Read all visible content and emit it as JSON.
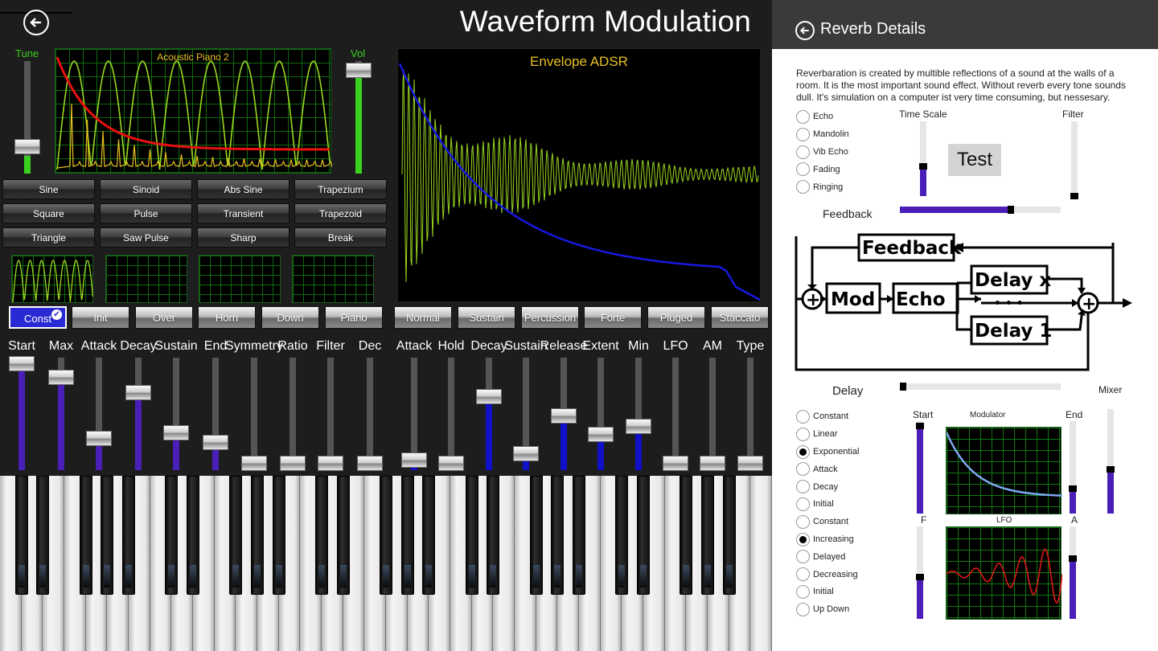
{
  "app": {
    "title": "Waveform Modulation"
  },
  "top_scope": {
    "label": "Acoustic Piano 2",
    "tune_label": "Tune",
    "vol_label": "Vol"
  },
  "envelope_scope": {
    "label": "Envelope ADSR"
  },
  "wave_buttons": [
    "Sine",
    "Sinoid",
    "Abs Sine",
    "Trapezium",
    "Square",
    "Pulse",
    "Transient",
    "Trapezoid",
    "Triangle",
    "Saw Pulse",
    "Sharp",
    "Break"
  ],
  "mode_buttons_left": [
    {
      "label": "Const",
      "active": true
    },
    {
      "label": "Init",
      "active": false
    },
    {
      "label": "Over",
      "active": false
    },
    {
      "label": "Horn",
      "active": false
    },
    {
      "label": "Down",
      "active": false
    },
    {
      "label": "Piano",
      "active": false
    }
  ],
  "mode_buttons_right": [
    {
      "label": "Normal"
    },
    {
      "label": "Sustain"
    },
    {
      "label": "Percussion"
    },
    {
      "label": "Forte"
    },
    {
      "label": "Pluged"
    },
    {
      "label": "Staccato"
    }
  ],
  "sliders": [
    {
      "label": "Start",
      "value": 0.95,
      "color": "#4a1fb8"
    },
    {
      "label": "Max",
      "value": 0.82,
      "color": "#4a1fb8"
    },
    {
      "label": "Attack",
      "value": 0.24,
      "color": "#4a1fb8"
    },
    {
      "label": "Decay",
      "value": 0.68,
      "color": "#4a1fb8"
    },
    {
      "label": "Sustain",
      "value": 0.29,
      "color": "#4a1fb8"
    },
    {
      "label": "End",
      "value": 0.2,
      "color": "#4a1fb8"
    },
    {
      "label": "Symmetry",
      "value": 0.0,
      "color": "#4a1fb8"
    },
    {
      "label": "Ratio",
      "value": 0.0,
      "color": "#4a1fb8"
    },
    {
      "label": "Filter",
      "value": 0.0,
      "color": "#4a1fb8"
    },
    {
      "label": "Dec",
      "value": 0.0,
      "color": "#4a1fb8"
    },
    {
      "label": "Attack",
      "value": 0.03,
      "color": "#1010c8"
    },
    {
      "label": "Hold",
      "value": 0.0,
      "color": "#1010c8"
    },
    {
      "label": "Decay",
      "value": 0.64,
      "color": "#1010c8"
    },
    {
      "label": "Sustain",
      "value": 0.09,
      "color": "#1010c8"
    },
    {
      "label": "Release",
      "value": 0.45,
      "color": "#1010c8"
    },
    {
      "label": "Extent",
      "value": 0.28,
      "color": "#1010c8"
    },
    {
      "label": "Min",
      "value": 0.35,
      "color": "#1010c8"
    },
    {
      "label": "LFO",
      "value": 0.0,
      "color": "#1010c8"
    },
    {
      "label": "AM",
      "value": 0.0,
      "color": "#1010c8"
    },
    {
      "label": "Type",
      "value": 0.0,
      "color": "#1010c8"
    }
  ],
  "reverb": {
    "title": "Reverb Details",
    "description": "Reverbaration is created by multible reflections of a sound at the walls of a room. It is the most important sound effect. Without reverb every tone sounds dull. It's simulation on a computer ist very time consuming, but nessesary.",
    "types": [
      {
        "label": "Echo",
        "selected": false
      },
      {
        "label": "Mandolin",
        "selected": false
      },
      {
        "label": "Vib Echo",
        "selected": false
      },
      {
        "label": "Fading",
        "selected": false
      },
      {
        "label": "Ringing",
        "selected": false
      }
    ],
    "time_scale_label": "Time Scale",
    "time_scale_value": 0.4,
    "filter_label": "Filter",
    "filter_value": 0.0,
    "test_label": "Test",
    "feedback_label": "Feedback",
    "feedback_value": 0.69,
    "diagram": {
      "feedback_box": "Feedback",
      "mod_box": "Mod",
      "echo_box": "Echo",
      "delay_x_box": "Delay x",
      "delay_1_box": "Delay 1",
      "sum_symbol": "+",
      "dots": "• • •"
    },
    "delay_label": "Delay",
    "delay_value": 0.0,
    "mixer_label": "Mixer",
    "mixer_value": 0.42,
    "start_label": "Start",
    "start_value": 0.95,
    "end_label": "End",
    "end_value": 0.27,
    "f_label": "F",
    "f_value": 0.45,
    "a_label": "A",
    "a_value": 0.65,
    "modulator_label": "Modulator",
    "lfo_label": "LFO",
    "modulation_types": [
      {
        "label": "Constant",
        "selected": false
      },
      {
        "label": "Linear",
        "selected": false
      },
      {
        "label": "Exponential",
        "selected": true
      },
      {
        "label": "Attack",
        "selected": false
      },
      {
        "label": "Decay",
        "selected": false
      },
      {
        "label": "Initial",
        "selected": false
      },
      {
        "label": "Constant",
        "selected": false
      },
      {
        "label": "Increasing",
        "selected": true
      },
      {
        "label": "Delayed",
        "selected": false
      },
      {
        "label": "Decreasing",
        "selected": false
      },
      {
        "label": "Initial",
        "selected": false
      },
      {
        "label": "Up Down",
        "selected": false
      }
    ]
  },
  "colors": {
    "accent": "#4a1fb8",
    "envelope": "#1010c8",
    "wave": "#9ad820",
    "scope_label": "#e8c020"
  }
}
